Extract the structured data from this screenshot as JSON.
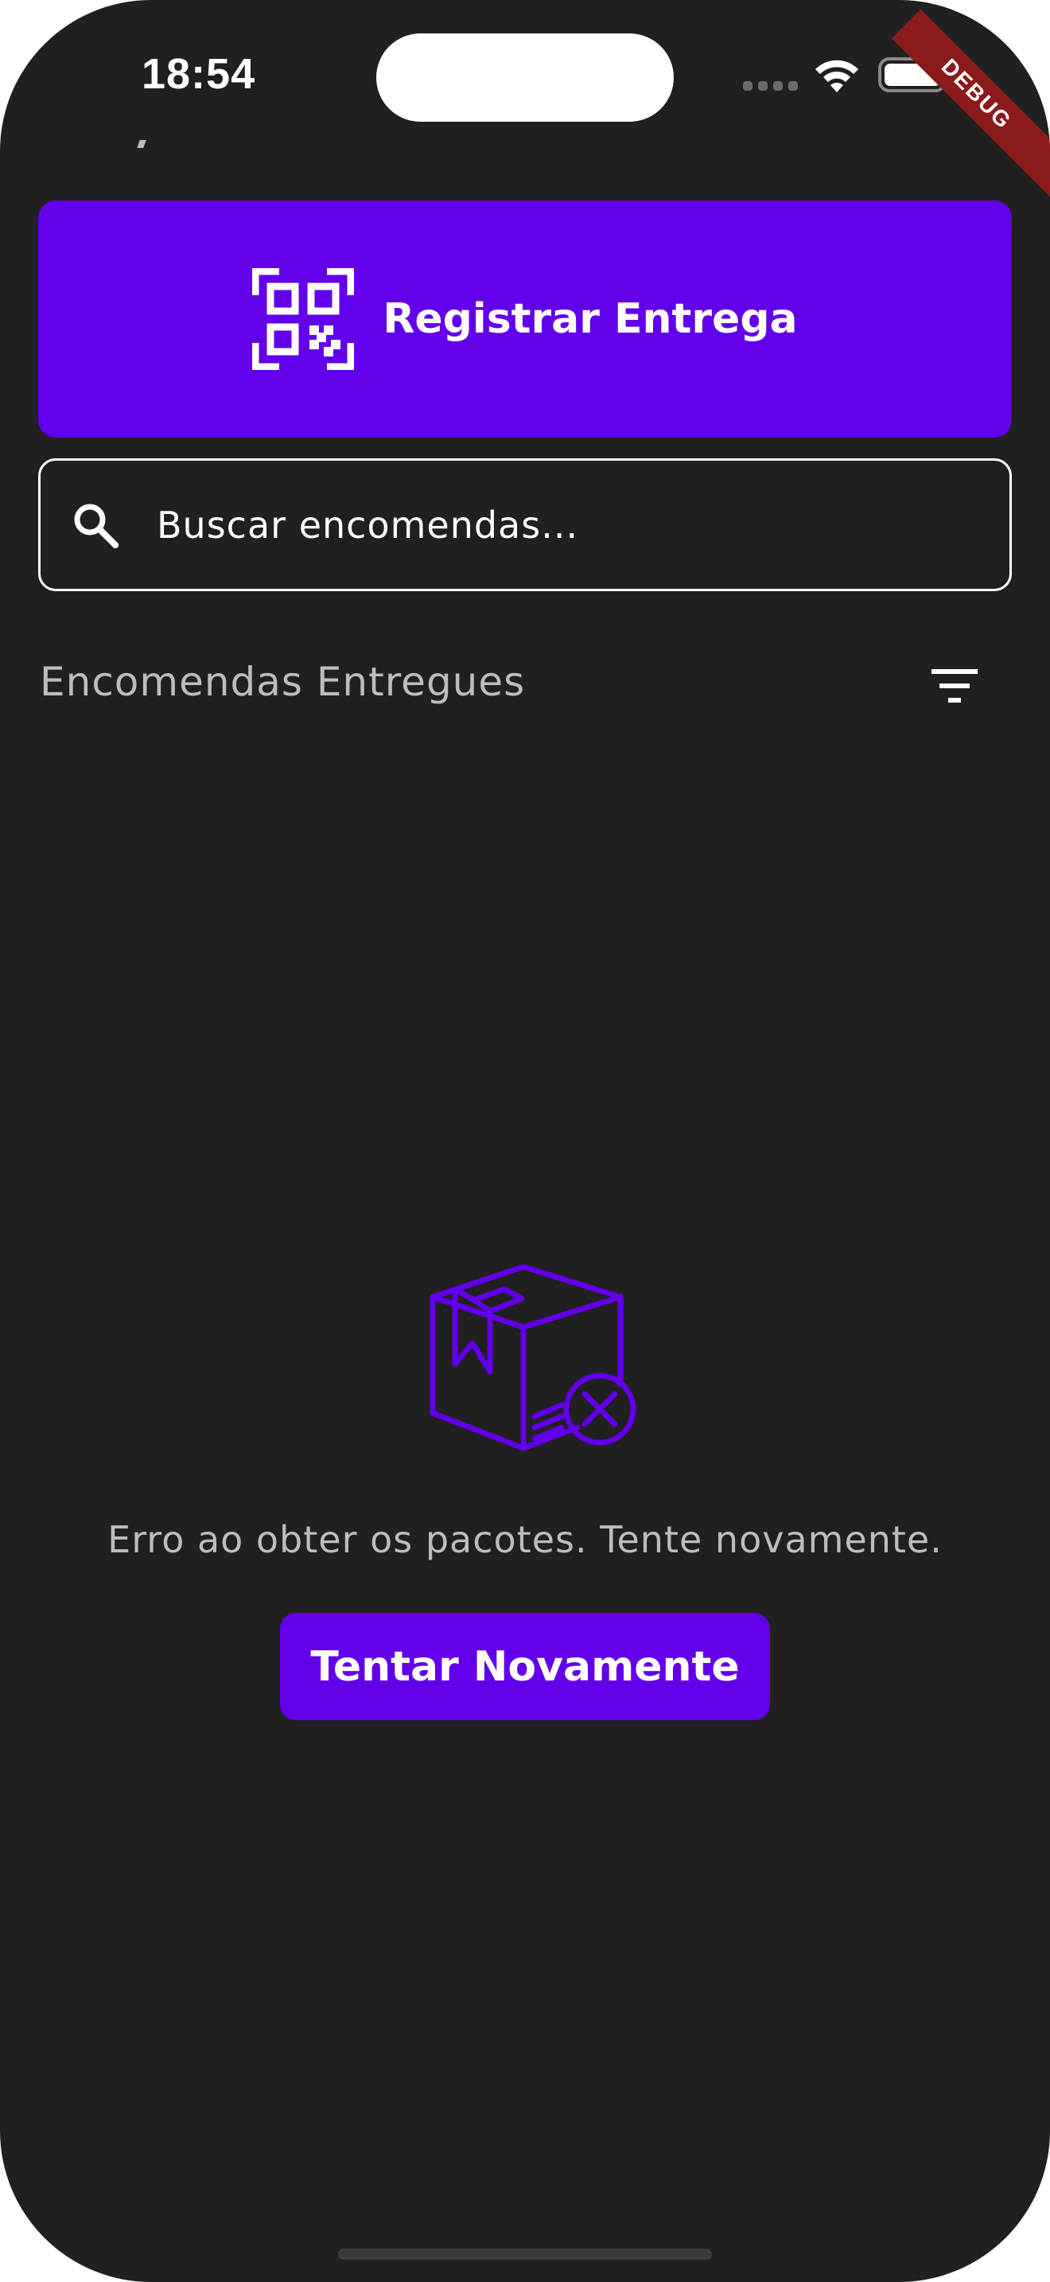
{
  "status_bar": {
    "time": "18:54"
  },
  "debug_banner": {
    "label": "DEBUG"
  },
  "register_button": {
    "label": "Registrar Entrega",
    "icon": "qr-code-scanner-icon"
  },
  "search": {
    "placeholder": "Buscar encomendas...",
    "icon": "search-icon"
  },
  "section": {
    "title": "Encomendas Entregues",
    "filter_icon": "filter-icon"
  },
  "empty_state": {
    "icon": "package-error-icon",
    "message": "Erro ao obter os pacotes. Tente novamente.",
    "retry_label": "Tentar Novamente"
  },
  "colors": {
    "background": "#202020",
    "accent": "#6200ea",
    "muted_text": "#bdbdbd",
    "debug_ribbon": "#8b1a1a"
  }
}
